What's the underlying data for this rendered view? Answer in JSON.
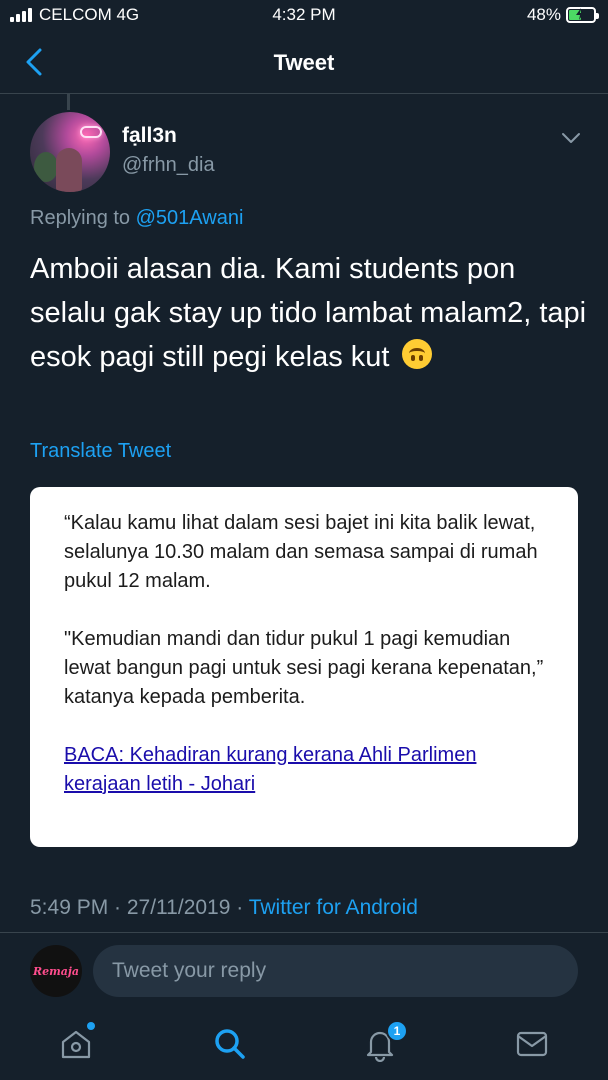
{
  "status_bar": {
    "carrier": "CELCOM 4G",
    "time": "4:32 PM",
    "battery_percent": "48%",
    "battery_level": 0.48
  },
  "header": {
    "title": "Tweet",
    "back_icon": "chevron-left-icon"
  },
  "tweet": {
    "display_name": "fạll3n",
    "handle": "@frhn_dia",
    "replying_prefix": "Replying to ",
    "replying_to": "@501Awani",
    "text": "Amboii alasan dia. Kami students pon selalu gak stay up tido lambat malam2, tapi esok pagi still pegi kelas kut",
    "emoji": "upside-down-face",
    "translate_label": "Translate Tweet",
    "timestamp": "5:49 PM · 27/11/2019 · ",
    "source": "Twitter for Android"
  },
  "quote_card": {
    "paragraph1": "“Kalau kamu lihat dalam sesi bajet ini kita balik lewat, selalunya 10.30 malam dan semasa sampai di rumah pukul 12 malam.",
    "paragraph2": "\"Kemudian mandi dan tidur pukul 1 pagi kemudian lewat bangun pagi untuk sesi pagi kerana kepenatan,” katanya kepada pemberita.",
    "link_text": "BACA: Kehadiran kurang kerana Ahli Parlimen kerajaan letih - Johari"
  },
  "reply_bar": {
    "avatar_text": "Remaja",
    "placeholder": "Tweet your reply"
  },
  "tab_bar": {
    "items": [
      {
        "icon": "home-icon",
        "has_dot": true
      },
      {
        "icon": "search-icon",
        "active": true
      },
      {
        "icon": "notifications-icon",
        "badge": "1"
      },
      {
        "icon": "messages-icon"
      }
    ]
  },
  "colors": {
    "background": "#15202b",
    "accent": "#1da1f2",
    "secondary_text": "#8899a6",
    "divider": "#38444d"
  }
}
